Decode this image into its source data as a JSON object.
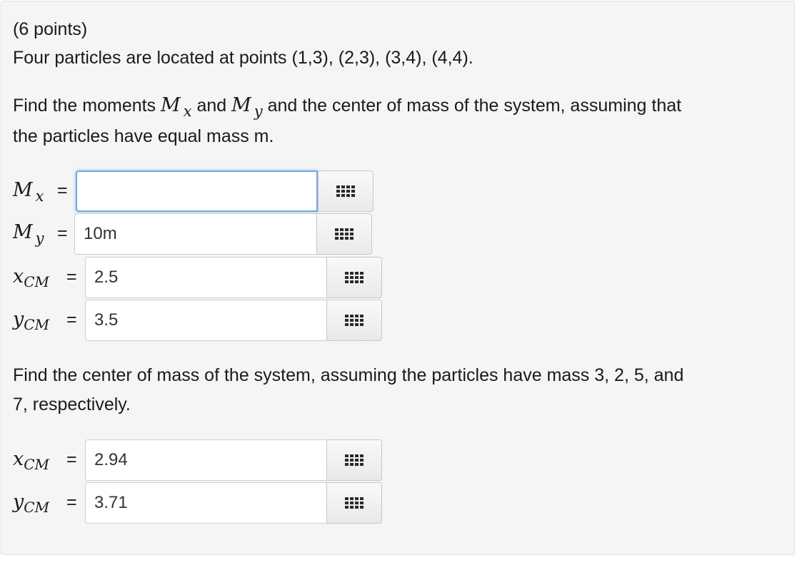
{
  "problem": {
    "points_label": "(6 points)",
    "statement": "Four particles are located at points (1,3), (2,3), (3,4), (4,4).",
    "part1": {
      "prefix": "Find the moments ",
      "moment_x_var": "M",
      "moment_x_sub": "x",
      "joiner": " and ",
      "moment_y_var": "M",
      "moment_y_sub": "y",
      "suffix": " and the center of mass of the system, assuming that",
      "line2": "the particles have equal mass m."
    },
    "part2": {
      "line1": "Find the center of mass of the system, assuming the particles have mass 3, 2, 5, and",
      "line2": "7, respectively."
    }
  },
  "answers_equal_mass": [
    {
      "var": "M",
      "sub": "x",
      "value": "",
      "focused": true
    },
    {
      "var": "M",
      "sub": "y",
      "value": "10m"
    },
    {
      "var": "x",
      "sub": "CM",
      "value": "2.5"
    },
    {
      "var": "y",
      "sub": "CM",
      "value": "3.5"
    }
  ],
  "answers_weighted": [
    {
      "var": "x",
      "sub": "CM",
      "value": "2.94"
    },
    {
      "var": "y",
      "sub": "CM",
      "value": "3.71"
    }
  ],
  "equals_sign": "=",
  "palette_icon": "keypad-grid-icon"
}
